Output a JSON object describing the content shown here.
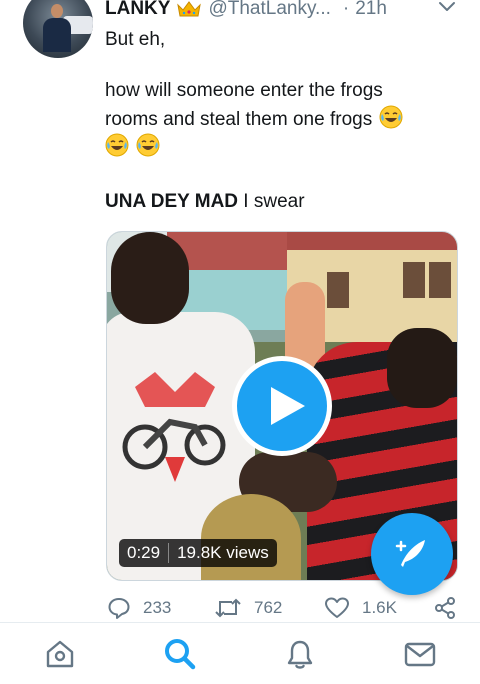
{
  "tweet": {
    "author_name": "LANKY",
    "author_badge_icon": "crown-icon",
    "handle": "@ThatLanky...",
    "separator": "·",
    "time": "21h",
    "lines": {
      "l1": "But eh,",
      "l2": "how will someone enter the frogs",
      "l3": "rooms and steal them one frogs",
      "l4_bold": "UNA DEY MAD",
      "l4_rest": " I swear"
    },
    "emoji_icon": "face-with-tears-of-joy-icon",
    "media": {
      "duration": "0:29",
      "views": "19.8K views"
    },
    "actions": {
      "replies": "233",
      "retweets": "762",
      "likes": "1.6K"
    }
  },
  "colors": {
    "accent": "#1da1f2",
    "text": "#14171a",
    "muted": "#657786"
  },
  "bottom_nav": {
    "items": [
      "home-icon",
      "search-icon",
      "notifications-icon",
      "messages-icon"
    ],
    "active": "search-icon"
  }
}
